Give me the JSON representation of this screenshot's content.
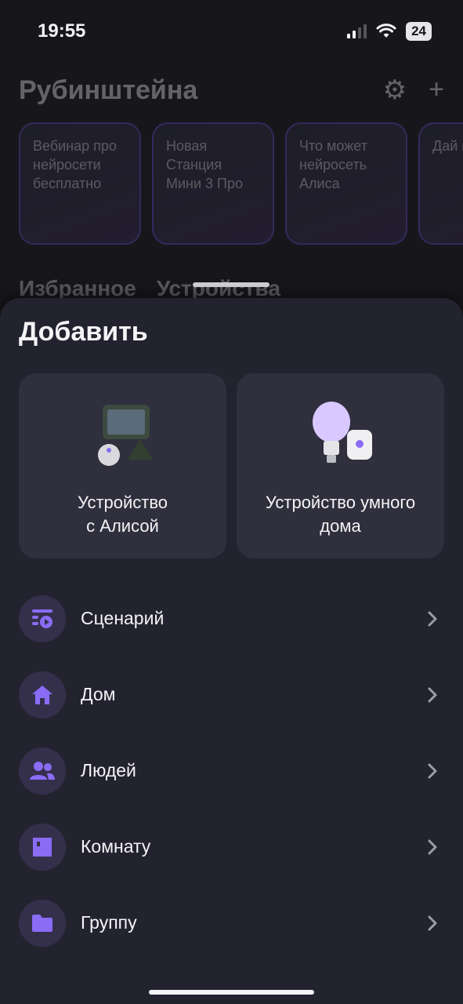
{
  "status": {
    "time": "19:55",
    "battery": "24"
  },
  "background": {
    "title": "Рубинштейна",
    "cards": [
      "Вебинар про нейросети бесплатно",
      "Новая Станция Мини 3 Про",
      "Что может нейросеть Алиса",
      "Дай июн"
    ],
    "tabs": [
      "Избранное",
      "Устройства"
    ]
  },
  "sheet": {
    "title": "Добавить",
    "cards": [
      {
        "label": "Устройство\nс Алисой"
      },
      {
        "label": "Устройство умного\nдома"
      }
    ],
    "items": [
      {
        "label": "Сценарий"
      },
      {
        "label": "Дом"
      },
      {
        "label": "Людей"
      },
      {
        "label": "Комнату"
      },
      {
        "label": "Группу"
      }
    ]
  },
  "colors": {
    "accent": "#8a6cf5",
    "sheet_bg": "#232330",
    "card_bg": "#2f2f3d",
    "icon_bg": "#34304c"
  }
}
